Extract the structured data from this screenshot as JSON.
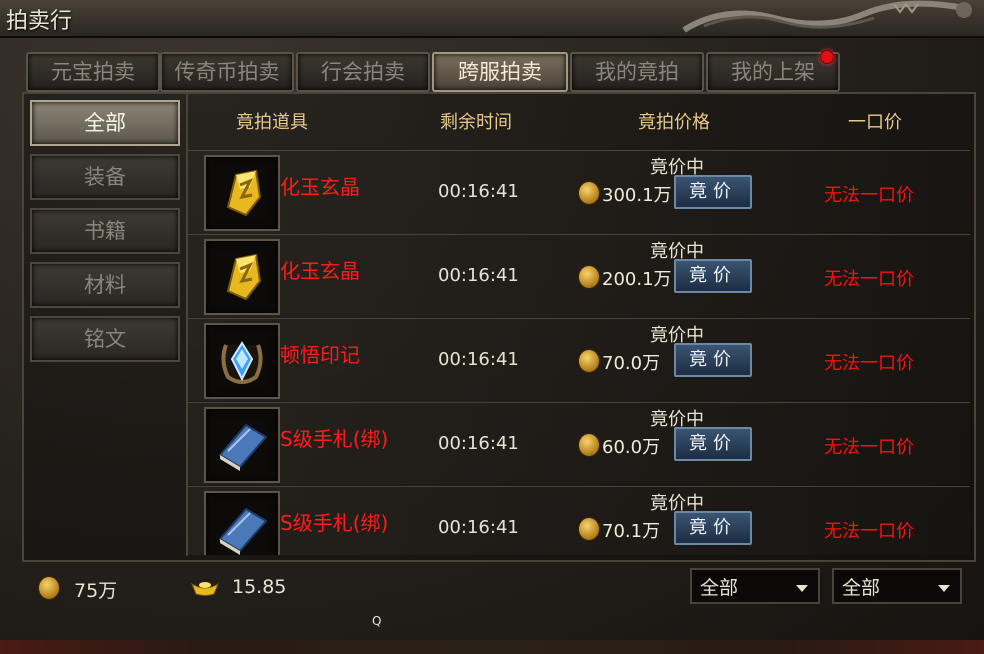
{
  "window": {
    "title": "拍卖行"
  },
  "tabs": [
    {
      "label": "元宝拍卖",
      "active": false
    },
    {
      "label": "传奇币拍卖",
      "active": false
    },
    {
      "label": "行会拍卖",
      "active": false
    },
    {
      "label": "跨服拍卖",
      "active": true
    },
    {
      "label": "我的竟拍",
      "active": false
    },
    {
      "label": "我的上架",
      "active": false,
      "badge": true
    }
  ],
  "categories": [
    {
      "label": "全部",
      "active": true
    },
    {
      "label": "装备",
      "active": false
    },
    {
      "label": "书籍",
      "active": false
    },
    {
      "label": "材料",
      "active": false
    },
    {
      "label": "铭文",
      "active": false
    }
  ],
  "columns": {
    "item": "竟拍道具",
    "time": "剩余时间",
    "price": "竟拍价格",
    "buyout": "一口价"
  },
  "rows": [
    {
      "icon": "gold-crystal-icon",
      "name": "化玉玄晶",
      "time": "00:16:41",
      "status": "竟价中",
      "price": "300.1万",
      "bid_label": "竟价",
      "buyout": "无法一口价"
    },
    {
      "icon": "gold-crystal-icon",
      "name": "化玉玄晶",
      "time": "00:16:41",
      "status": "竟价中",
      "price": "200.1万",
      "bid_label": "竟价",
      "buyout": "无法一口价"
    },
    {
      "icon": "blue-gem-emblem-icon",
      "name": "顿悟印记",
      "time": "00:16:41",
      "status": "竟价中",
      "price": "70.0万",
      "bid_label": "竟价",
      "buyout": "无法一口价"
    },
    {
      "icon": "blue-book-icon",
      "name": "S级手札(绑)",
      "time": "00:16:41",
      "status": "竟价中",
      "price": "60.0万",
      "bid_label": "竟价",
      "buyout": "无法一口价"
    },
    {
      "icon": "blue-book-icon",
      "name": "S级手札(绑)",
      "time": "00:16:41",
      "status": "竟价中",
      "price": "70.1万",
      "bid_label": "竟价",
      "buyout": "无法一口价"
    }
  ],
  "wallet": {
    "coin_amount": "75万",
    "ingot_amount": "15.85"
  },
  "filters": [
    {
      "selected": "全部"
    },
    {
      "selected": "全部"
    }
  ],
  "footer_glyph": "Q",
  "colors": {
    "item_name": "#ff1c1c",
    "header": "#e7c98a",
    "bid_button": "#2a4060",
    "badge": "#e01010"
  }
}
